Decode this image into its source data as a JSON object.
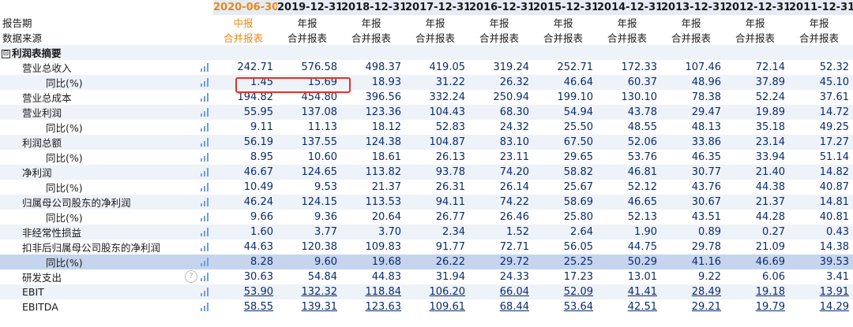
{
  "header": {
    "dates": [
      "2020-06-30",
      "2019-12-31",
      "2018-12-31",
      "2017-12-31",
      "2016-12-31",
      "2015-12-31",
      "2014-12-31",
      "2013-12-31",
      "2012-12-31",
      "2011-12-31"
    ]
  },
  "meta": {
    "period_label": "报告期",
    "periods": [
      "中报",
      "年报",
      "年报",
      "年报",
      "年报",
      "年报",
      "年报",
      "年报",
      "年报",
      "年报"
    ],
    "source_label": "数据来源",
    "sources": [
      "合并报表",
      "合并报表",
      "合并报表",
      "合并报表",
      "合并报表",
      "合并报表",
      "合并报表",
      "合并报表",
      "合并报表",
      "合并报表"
    ]
  },
  "section": {
    "toggle": "⊟",
    "title": "利润表摘要"
  },
  "rows": [
    {
      "label": "营业总收入",
      "level": 1,
      "values": [
        "242.71",
        "576.58",
        "498.37",
        "419.05",
        "319.24",
        "252.71",
        "172.33",
        "107.46",
        "72.14",
        "52.32"
      ]
    },
    {
      "label": "同比(%)",
      "level": 2,
      "values": [
        "1.45",
        "15.69",
        "18.93",
        "31.22",
        "26.32",
        "46.64",
        "60.37",
        "48.96",
        "37.89",
        "45.10"
      ]
    },
    {
      "label": "营业总成本",
      "level": 1,
      "values": [
        "194.82",
        "454.80",
        "396.56",
        "332.24",
        "250.94",
        "199.10",
        "130.10",
        "78.38",
        "52.24",
        "37.61"
      ]
    },
    {
      "label": "营业利润",
      "level": 1,
      "values": [
        "55.95",
        "137.08",
        "123.36",
        "104.43",
        "68.30",
        "54.94",
        "43.78",
        "29.47",
        "19.89",
        "14.72"
      ]
    },
    {
      "label": "同比(%)",
      "level": 2,
      "values": [
        "9.11",
        "11.13",
        "18.12",
        "52.83",
        "24.32",
        "25.50",
        "48.55",
        "48.13",
        "35.18",
        "49.25"
      ]
    },
    {
      "label": "利润总额",
      "level": 1,
      "values": [
        "56.19",
        "137.55",
        "124.38",
        "104.87",
        "83.10",
        "67.50",
        "52.06",
        "33.86",
        "23.14",
        "17.27"
      ]
    },
    {
      "label": "同比(%)",
      "level": 2,
      "values": [
        "8.95",
        "10.60",
        "18.61",
        "26.13",
        "23.11",
        "29.65",
        "53.76",
        "46.35",
        "33.94",
        "51.14"
      ]
    },
    {
      "label": "净利润",
      "level": 1,
      "values": [
        "46.67",
        "124.65",
        "113.82",
        "93.78",
        "74.20",
        "58.82",
        "46.81",
        "30.77",
        "21.40",
        "14.82"
      ]
    },
    {
      "label": "同比(%)",
      "level": 2,
      "values": [
        "10.49",
        "9.53",
        "21.37",
        "26.31",
        "26.14",
        "25.67",
        "52.12",
        "43.76",
        "44.38",
        "40.87"
      ]
    },
    {
      "label": "归属母公司股东的净利润",
      "level": 1,
      "values": [
        "46.24",
        "124.15",
        "113.53",
        "94.11",
        "74.22",
        "58.69",
        "46.65",
        "30.67",
        "21.37",
        "14.81"
      ]
    },
    {
      "label": "同比(%)",
      "level": 2,
      "values": [
        "9.66",
        "9.36",
        "20.64",
        "26.77",
        "26.46",
        "25.80",
        "52.13",
        "43.51",
        "44.28",
        "40.81"
      ]
    },
    {
      "label": "非经常性损益",
      "level": 1,
      "values": [
        "1.60",
        "3.77",
        "3.70",
        "2.34",
        "1.52",
        "2.64",
        "1.90",
        "0.89",
        "0.27",
        "0.43"
      ]
    },
    {
      "label": "扣非后归属母公司股东的净利润",
      "level": 1,
      "values": [
        "44.63",
        "120.38",
        "109.83",
        "91.77",
        "72.71",
        "56.05",
        "44.75",
        "29.78",
        "21.09",
        "14.38"
      ]
    },
    {
      "label": "同比(%)",
      "level": 2,
      "values": [
        "8.28",
        "9.60",
        "19.68",
        "26.22",
        "29.72",
        "25.25",
        "50.29",
        "41.16",
        "46.69",
        "39.53"
      ]
    },
    {
      "label": "研发支出",
      "level": 1,
      "help": "?",
      "values": [
        "30.63",
        "54.84",
        "44.83",
        "31.94",
        "24.33",
        "17.23",
        "13.01",
        "9.22",
        "6.06",
        "3.41"
      ]
    },
    {
      "label": "EBIT",
      "level": 1,
      "values": [
        "53.90",
        "132.32",
        "118.84",
        "106.20",
        "66.04",
        "52.09",
        "41.41",
        "28.49",
        "19.18",
        "13.91"
      ]
    },
    {
      "label": "EBITDA",
      "level": 1,
      "values": [
        "58.55",
        "139.31",
        "123.63",
        "109.61",
        "68.44",
        "53.64",
        "42.51",
        "29.21",
        "19.79",
        "14.29"
      ]
    }
  ]
}
